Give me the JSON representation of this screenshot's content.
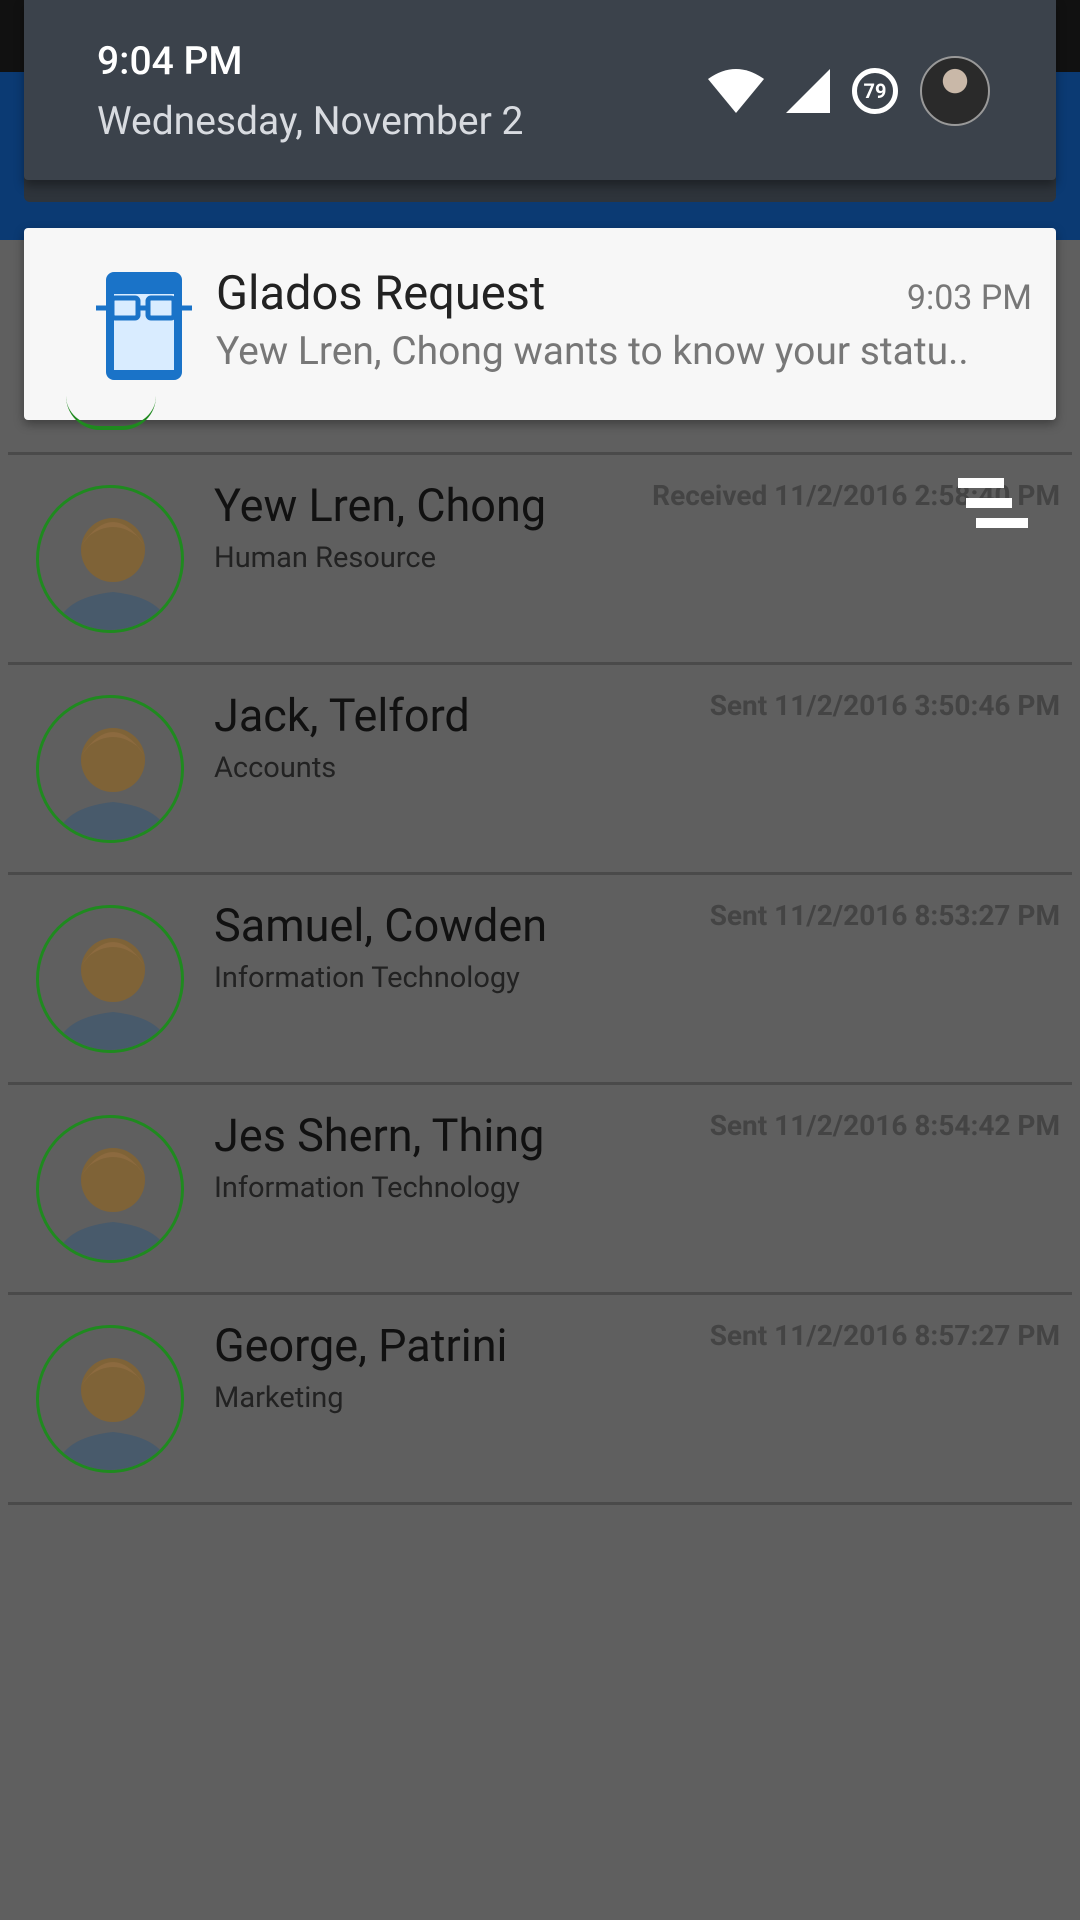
{
  "shade": {
    "time": "9:04 PM",
    "date": "Wednesday, November 2",
    "battery_level": "79"
  },
  "notification": {
    "app": "Glados Request",
    "time": "9:03 PM",
    "message": "Yew Lren, Chong wants to know your statu.."
  },
  "contacts": [
    {
      "name": "Yew Lren, Chong",
      "department": "Human Resource",
      "status": "Received 11/2/2016 2:58:40 PM"
    },
    {
      "name": "Jack, Telford",
      "department": "Accounts",
      "status": "Sent 11/2/2016 3:50:46 PM"
    },
    {
      "name": "Samuel, Cowden",
      "department": "Information Technology",
      "status": "Sent 11/2/2016 8:53:27 PM"
    },
    {
      "name": "Jes Shern, Thing",
      "department": "Information Technology",
      "status": "Sent 11/2/2016 8:54:42 PM"
    },
    {
      "name": "George, Patrini",
      "department": "Marketing",
      "status": "Sent 11/2/2016 8:57:27 PM"
    }
  ],
  "icons": {
    "wifi": "wifi-icon",
    "signal": "signal-icon",
    "battery": "battery-icon",
    "user": "user-avatar-icon",
    "app": "glados-app-icon",
    "menu": "stack-menu-icon"
  }
}
